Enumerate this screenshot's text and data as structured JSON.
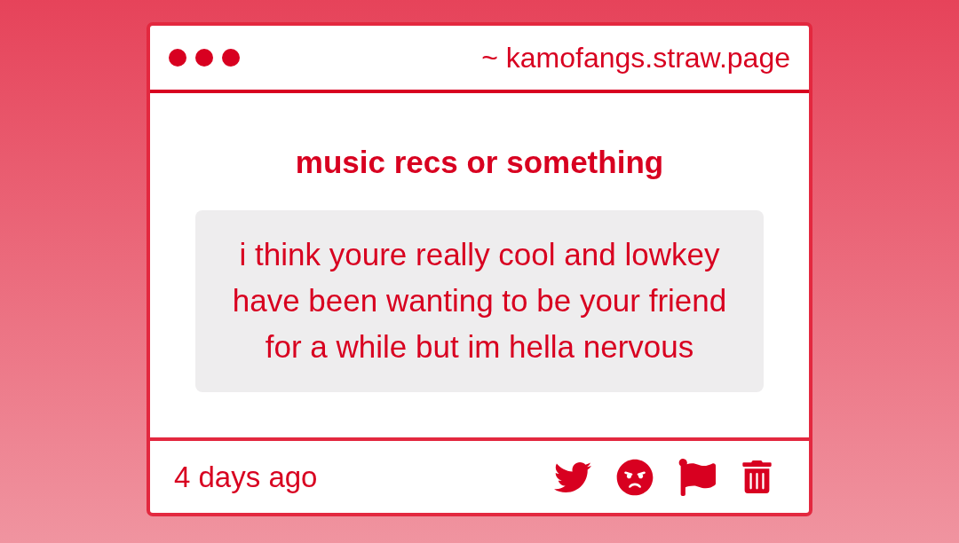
{
  "window": {
    "address": "~ kamofangs.straw.page"
  },
  "post": {
    "title": "music recs or something",
    "message": "i think youre really cool and lowkey\nhave been wanting to be your friend\nfor a while but im hella nervous",
    "time": "4 days ago"
  }
}
